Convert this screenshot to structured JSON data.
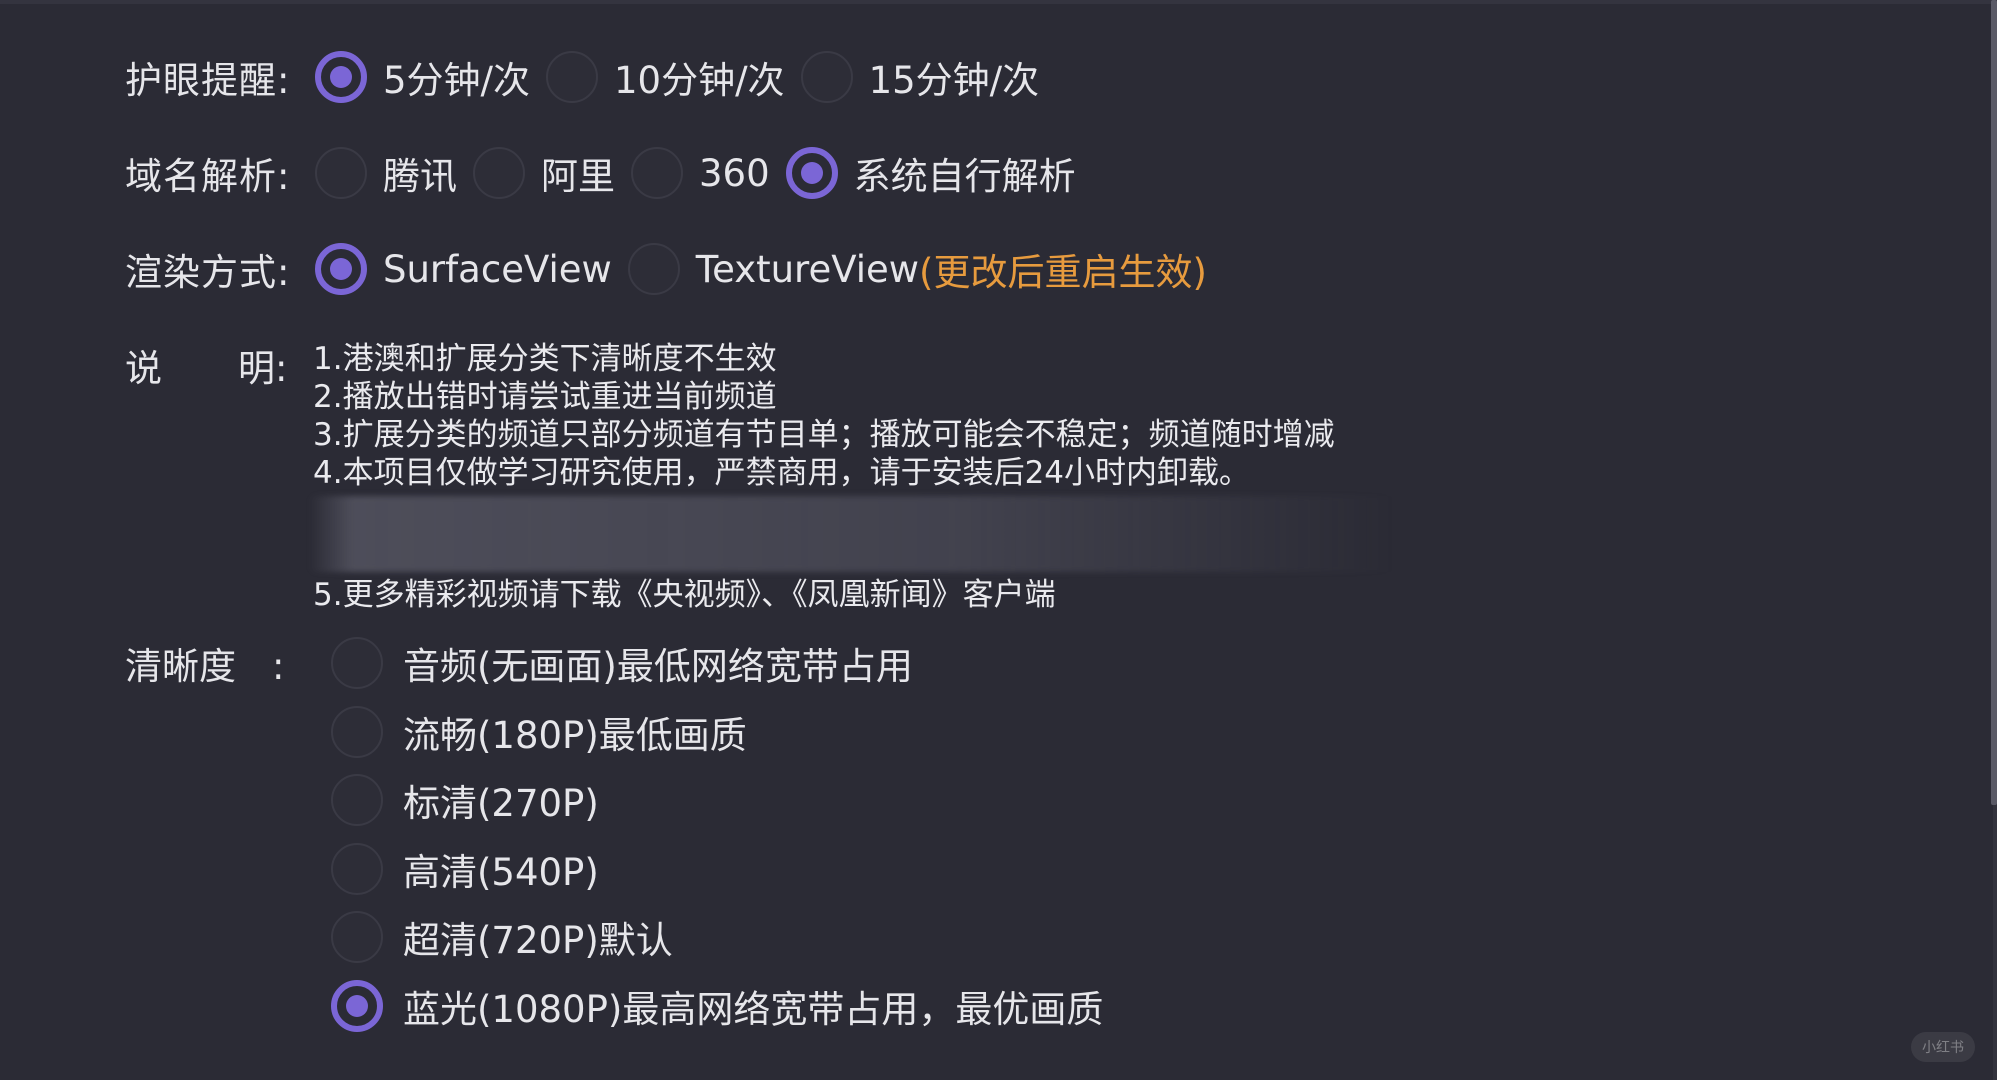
{
  "eye_care": {
    "label": "护眼提醒:",
    "options": [
      {
        "label": "5分钟/次",
        "selected": true
      },
      {
        "label": "10分钟/次",
        "selected": false
      },
      {
        "label": "15分钟/次",
        "selected": false
      }
    ]
  },
  "dns": {
    "label": "域名解析:",
    "options": [
      {
        "label": "腾讯",
        "selected": false
      },
      {
        "label": "阿里",
        "selected": false
      },
      {
        "label": "360",
        "selected": false
      },
      {
        "label": "系统自行解析",
        "selected": true
      }
    ]
  },
  "render": {
    "label": "渲染方式:",
    "options": [
      {
        "label": "SurfaceView",
        "selected": true
      },
      {
        "label": "TextureView",
        "selected": false
      }
    ],
    "notice": "(更改后重启生效)"
  },
  "notes": {
    "label_left": "说",
    "label_right": "明:",
    "lines": [
      "1.港澳和扩展分类下清晰度不生效",
      "2.播放出错时请尝试重进当前频道",
      "3.扩展分类的频道只部分频道有节目单；播放可能会不稳定；频道随时增减",
      "4.本项目仅做学习研究使用，严禁商用，请于安装后24小时内卸载。"
    ],
    "last_line": "5.更多精彩视频请下载《央视频》、《凤凰新闻》客户端"
  },
  "quality": {
    "label": "清晰度",
    "colon": ":",
    "options": [
      {
        "label": "音频(无画面)最低网络宽带占用",
        "selected": false
      },
      {
        "label": "流畅(180P)最低画质",
        "selected": false
      },
      {
        "label": "标清(270P)",
        "selected": false
      },
      {
        "label": "高清(540P)",
        "selected": false
      },
      {
        "label": "超清(720P)默认",
        "selected": false
      },
      {
        "label": "蓝光(1080P)最高网络宽带占用，最优画质",
        "selected": true
      }
    ]
  },
  "watermark": "小红书",
  "colors": {
    "background": "#2b2b35",
    "accent": "#7b66d6",
    "notice": "#e79b3e",
    "text": "#e6e6ea"
  }
}
